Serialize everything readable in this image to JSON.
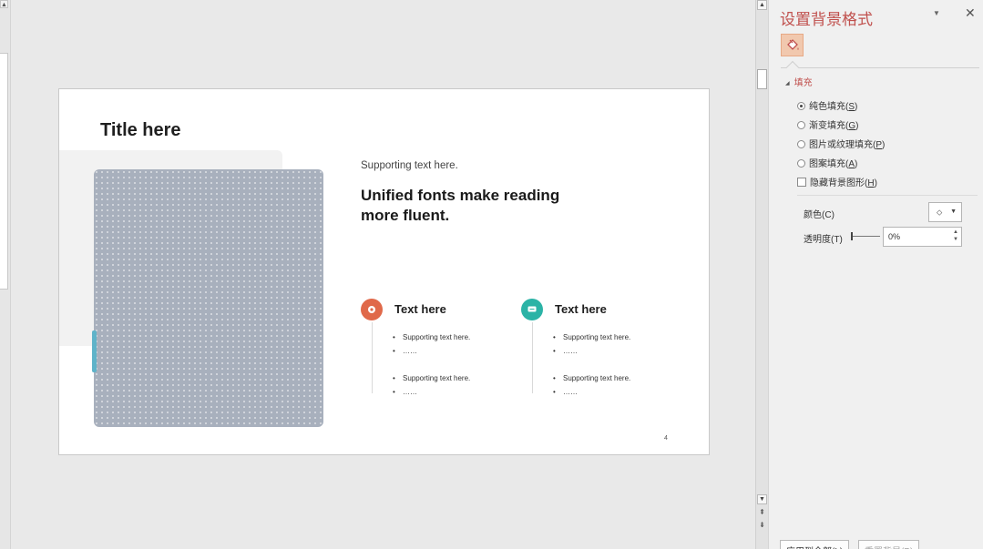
{
  "slide": {
    "title": "Title here",
    "supporting_top": "Supporting text here.",
    "headline": "Unified fonts make reading more fluent.",
    "columns": [
      {
        "title": "Text here",
        "icon": "location-pin-icon",
        "color": "#e0694a",
        "bullets": [
          "Supporting text here.",
          "……",
          "Supporting text here.",
          "……"
        ]
      },
      {
        "title": "Text here",
        "icon": "chat-bubble-icon",
        "color": "#2bb3a6",
        "bullets": [
          "Supporting text here.",
          "……",
          "Supporting text here.",
          "……"
        ]
      }
    ],
    "page_number": "4"
  },
  "pane": {
    "title": "设置背景格式",
    "section_fill": "填充",
    "options": {
      "solid": "纯色填充(",
      "solid_key": "S",
      "gradient": "渐变填充(",
      "gradient_key": "G",
      "picture": "图片或纹理填充(",
      "picture_key": "P",
      "pattern": "图案填充(",
      "pattern_key": "A",
      "hide": "隐藏背景图形(",
      "hide_key": "H"
    },
    "selected_option": "solid",
    "color_label": "颜色(",
    "color_key": "C",
    "transparency_label": "透明度(",
    "transparency_key": "T",
    "transparency_value": "0%",
    "apply_all": "应用到全部(L)",
    "reset": "重置背景(B)"
  },
  "colors": {
    "accent_red": "#c0504d",
    "fill_tab": "#f1c8ae"
  }
}
